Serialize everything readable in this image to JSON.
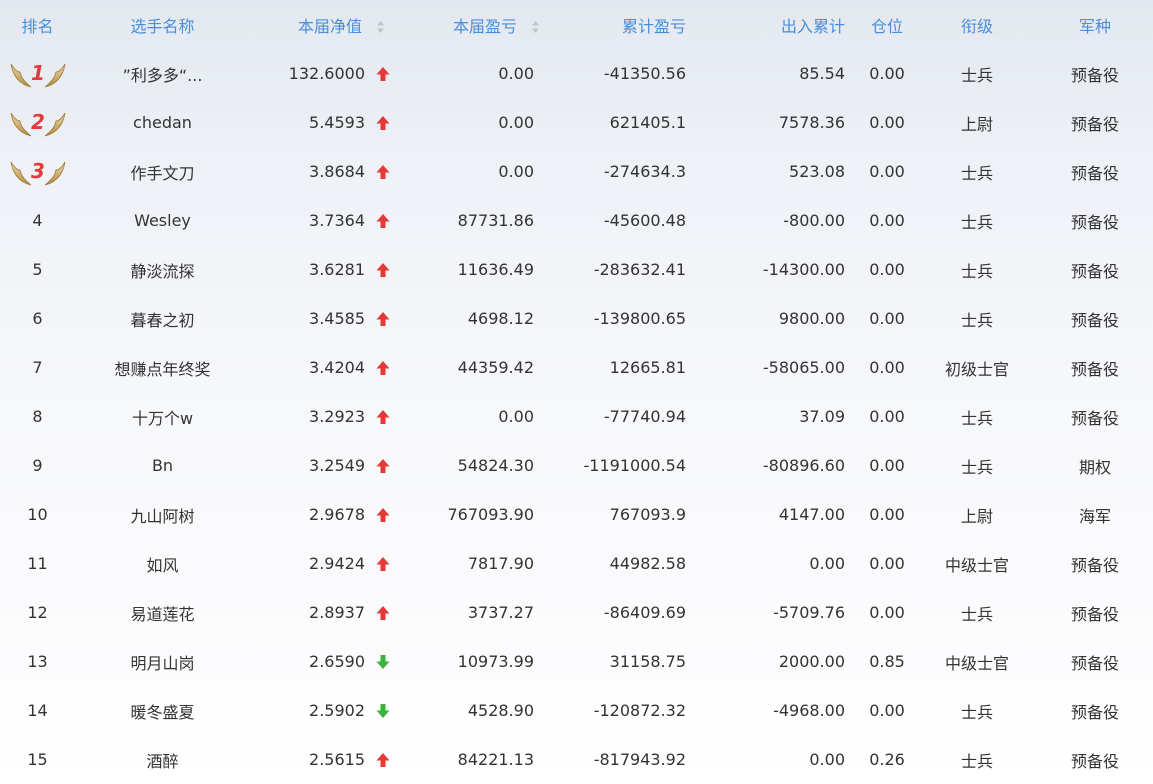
{
  "colors": {
    "header_text": "#4a8fd9",
    "up_arrow": "#e53935",
    "down_arrow": "#3bb33b",
    "medal_wing": "#c9a55a",
    "medal_number": "#e23b3b"
  },
  "header": {
    "rank": "排名",
    "name": "选手名称",
    "net_value": "本届净值",
    "profit": "本届盈亏",
    "cumulative_profit": "累计盈亏",
    "in_out": "出入累计",
    "position": "仓位",
    "title": "衔级",
    "branch": "军种"
  },
  "rows": [
    {
      "rank": "1",
      "medal": true,
      "name": "”利多多“...",
      "net": "132.6000",
      "trend": "up",
      "profit": "0.00",
      "cum": "-41350.56",
      "io": "85.54",
      "pos": "0.00",
      "title": "士兵",
      "branch": "预备役"
    },
    {
      "rank": "2",
      "medal": true,
      "name": "chedan",
      "net": "5.4593",
      "trend": "up",
      "profit": "0.00",
      "cum": "621405.1",
      "io": "7578.36",
      "pos": "0.00",
      "title": "上尉",
      "branch": "预备役"
    },
    {
      "rank": "3",
      "medal": true,
      "name": "作手文刀",
      "net": "3.8684",
      "trend": "up",
      "profit": "0.00",
      "cum": "-274634.3",
      "io": "523.08",
      "pos": "0.00",
      "title": "士兵",
      "branch": "预备役"
    },
    {
      "rank": "4",
      "medal": false,
      "name": "Wesley",
      "net": "3.7364",
      "trend": "up",
      "profit": "87731.86",
      "cum": "-45600.48",
      "io": "-800.00",
      "pos": "0.00",
      "title": "士兵",
      "branch": "预备役"
    },
    {
      "rank": "5",
      "medal": false,
      "name": "静淡流探",
      "net": "3.6281",
      "trend": "up",
      "profit": "11636.49",
      "cum": "-283632.41",
      "io": "-14300.00",
      "pos": "0.00",
      "title": "士兵",
      "branch": "预备役"
    },
    {
      "rank": "6",
      "medal": false,
      "name": "暮春之初",
      "net": "3.4585",
      "trend": "up",
      "profit": "4698.12",
      "cum": "-139800.65",
      "io": "9800.00",
      "pos": "0.00",
      "title": "士兵",
      "branch": "预备役"
    },
    {
      "rank": "7",
      "medal": false,
      "name": "想赚点年终奖",
      "net": "3.4204",
      "trend": "up",
      "profit": "44359.42",
      "cum": "12665.81",
      "io": "-58065.00",
      "pos": "0.00",
      "title": "初级士官",
      "branch": "预备役"
    },
    {
      "rank": "8",
      "medal": false,
      "name": "十万个w",
      "net": "3.2923",
      "trend": "up",
      "profit": "0.00",
      "cum": "-77740.94",
      "io": "37.09",
      "pos": "0.00",
      "title": "士兵",
      "branch": "预备役"
    },
    {
      "rank": "9",
      "medal": false,
      "name": "Bn",
      "net": "3.2549",
      "trend": "up",
      "profit": "54824.30",
      "cum": "-1191000.54",
      "io": "-80896.60",
      "pos": "0.00",
      "title": "士兵",
      "branch": "期权"
    },
    {
      "rank": "10",
      "medal": false,
      "name": "九山阿树",
      "net": "2.9678",
      "trend": "up",
      "profit": "767093.90",
      "cum": "767093.9",
      "io": "4147.00",
      "pos": "0.00",
      "title": "上尉",
      "branch": "海军"
    },
    {
      "rank": "11",
      "medal": false,
      "name": "如风",
      "net": "2.9424",
      "trend": "up",
      "profit": "7817.90",
      "cum": "44982.58",
      "io": "0.00",
      "pos": "0.00",
      "title": "中级士官",
      "branch": "预备役"
    },
    {
      "rank": "12",
      "medal": false,
      "name": "易道莲花",
      "net": "2.8937",
      "trend": "up",
      "profit": "3737.27",
      "cum": "-86409.69",
      "io": "-5709.76",
      "pos": "0.00",
      "title": "士兵",
      "branch": "预备役"
    },
    {
      "rank": "13",
      "medal": false,
      "name": "明月山岗",
      "net": "2.6590",
      "trend": "down",
      "profit": "10973.99",
      "cum": "31158.75",
      "io": "2000.00",
      "pos": "0.85",
      "title": "中级士官",
      "branch": "预备役"
    },
    {
      "rank": "14",
      "medal": false,
      "name": "暖冬盛夏",
      "net": "2.5902",
      "trend": "down",
      "profit": "4528.90",
      "cum": "-120872.32",
      "io": "-4968.00",
      "pos": "0.00",
      "title": "士兵",
      "branch": "预备役"
    },
    {
      "rank": "15",
      "medal": false,
      "name": "酒醉",
      "net": "2.5615",
      "trend": "up",
      "profit": "84221.13",
      "cum": "-817943.92",
      "io": "0.00",
      "pos": "0.26",
      "title": "士兵",
      "branch": "预备役"
    }
  ]
}
